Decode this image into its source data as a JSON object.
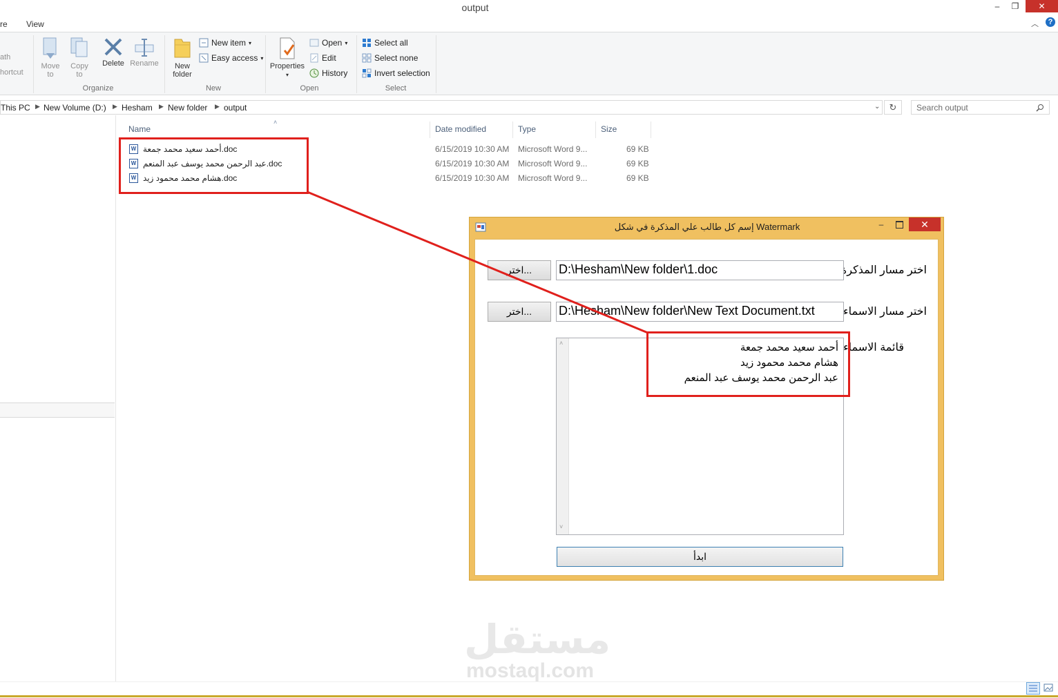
{
  "window": {
    "title": "output",
    "minimize": "–",
    "maximize": "❐",
    "close": "✕"
  },
  "tabs": [
    "re",
    "View"
  ],
  "ribbon": {
    "clipboard": {
      "path_label": "ath",
      "shortcut_label": "hortcut"
    },
    "organize": {
      "move_to": "Move to",
      "copy_to": "Copy to",
      "delete": "Delete",
      "rename": "Rename",
      "label": "Organize"
    },
    "new": {
      "new_folder": "New folder",
      "new_item": "New item",
      "easy_access": "Easy access",
      "label": "New"
    },
    "open": {
      "properties": "Properties",
      "open": "Open",
      "edit": "Edit",
      "history": "History",
      "label": "Open"
    },
    "select": {
      "select_all": "Select all",
      "select_none": "Select none",
      "invert_selection": "Invert selection",
      "label": "Select"
    }
  },
  "address": {
    "crumbs": [
      "This PC",
      "New Volume (D:)",
      "Hesham",
      "New folder",
      "output"
    ],
    "search_placeholder": "Search output"
  },
  "columns": {
    "name": "Name",
    "date_modified": "Date modified",
    "type": "Type",
    "size": "Size"
  },
  "files": [
    {
      "name": "أحمد سعيد محمد جمعة.doc",
      "date": "6/15/2019 10:30 AM",
      "type": "Microsoft Word 9...",
      "size": "69 KB"
    },
    {
      "name": "عبد الرحمن محمد يوسف عبد المنعم.doc",
      "date": "6/15/2019 10:30 AM",
      "type": "Microsoft Word 9...",
      "size": "69 KB"
    },
    {
      "name": "هشام محمد محمود زيد.doc",
      "date": "6/15/2019 10:30 AM",
      "type": "Microsoft Word 9...",
      "size": "69 KB"
    }
  ],
  "dialog": {
    "title": "إسم كل طالب علي المذكرة في شكل Watermark",
    "doc_path_label": "اختر مسار المذكرة",
    "doc_path_value": "D:\\Hesham\\New folder\\1.doc",
    "doc_browse_button": "اختر...",
    "names_path_label": "اختر مسار الاسماء",
    "names_path_value": "D:\\Hesham\\New folder\\New Text Document.txt",
    "names_browse_button": "اختر...",
    "names_list_label": "قائمة الاسماء",
    "names_list": [
      "أحمد سعيد محمد جمعة",
      "هشام محمد محمود زيد",
      "عبد الرحمن محمد يوسف عبد المنعم"
    ],
    "start_button": "ابدأ"
  },
  "watermark": {
    "arabic": "مستقل",
    "latin": "mostaql.com"
  },
  "colors": {
    "dialog_frame": "#f0c060",
    "annotation": "#e0201c",
    "close_red": "#c7312a"
  }
}
